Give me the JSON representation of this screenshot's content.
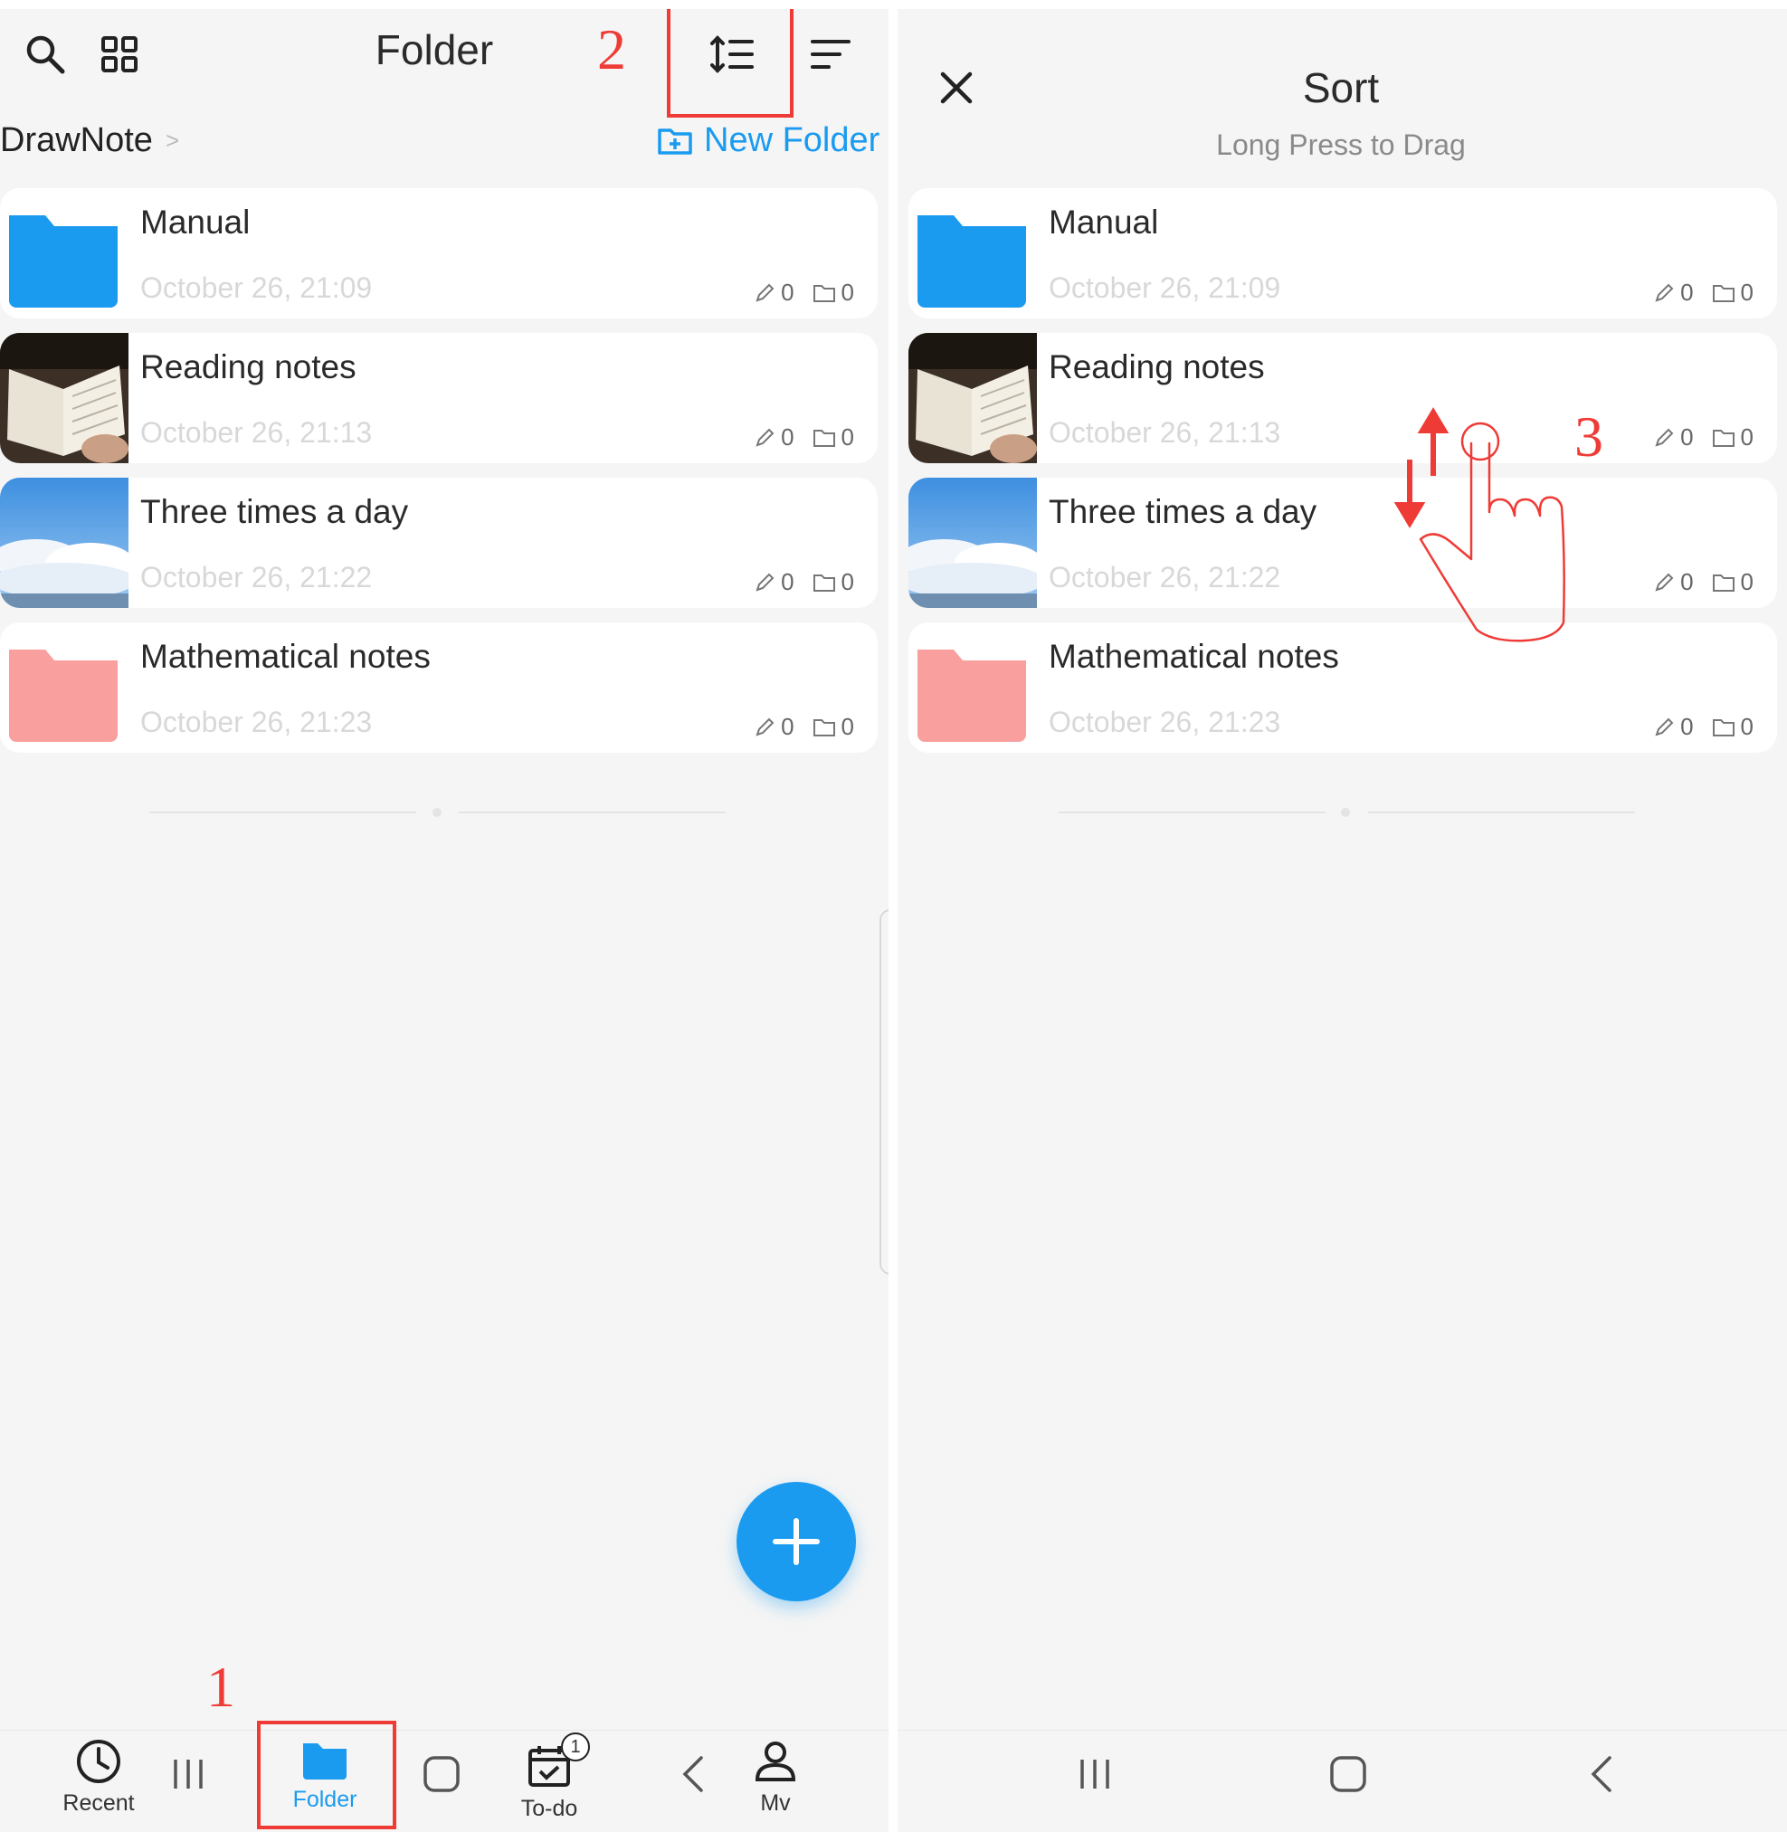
{
  "left": {
    "header": {
      "title": "Folder",
      "search_icon": "search-icon",
      "grid_icon": "grid-view-icon",
      "sort_icon": "sort-order-icon",
      "filter_icon": "filter-lines-icon"
    },
    "breadcrumb": {
      "root": "DrawNote",
      "chevron": ">"
    },
    "new_folder_label": "New Folder",
    "folders": [
      {
        "name": "Manual",
        "date": "October 26, 21:09",
        "notes": "0",
        "subfolders": "0",
        "thumb": "blue-folder"
      },
      {
        "name": "Reading notes",
        "date": "October 26, 21:13",
        "notes": "0",
        "subfolders": "0",
        "thumb": "book-photo"
      },
      {
        "name": "Three times a day",
        "date": "October 26, 21:22",
        "notes": "0",
        "subfolders": "0",
        "thumb": "sky-photo"
      },
      {
        "name": "Mathematical notes",
        "date": "October 26, 21:23",
        "notes": "0",
        "subfolders": "0",
        "thumb": "pink-folder"
      }
    ],
    "fab_icon": "plus-icon",
    "nav": [
      {
        "label": "Recent",
        "icon": "clock-icon"
      },
      {
        "label": "Folder",
        "icon": "folder-icon",
        "active": true
      },
      {
        "label": "To-do",
        "icon": "calendar-check-icon",
        "badge": "1"
      },
      {
        "label": "Mv",
        "icon": "person-icon"
      }
    ]
  },
  "right": {
    "header": {
      "title": "Sort",
      "subtitle": "Long Press to Drag",
      "close_icon": "close-icon"
    },
    "folders": [
      {
        "name": "Manual",
        "date": "October 26, 21:09",
        "notes": "0",
        "subfolders": "0"
      },
      {
        "name": "Reading notes",
        "date": "October 26, 21:13",
        "notes": "0",
        "subfolders": "0"
      },
      {
        "name": "Three times a day",
        "date": "October 26, 21:22",
        "notes": "0",
        "subfolders": "0"
      },
      {
        "name": "Mathematical notes",
        "date": "October 26, 21:23",
        "notes": "0",
        "subfolders": "0"
      }
    ]
  },
  "annotations": {
    "step1": "1",
    "step2": "2",
    "step3": "3"
  },
  "colors": {
    "accent": "#1a9bf0",
    "pink_folder": "#f9a09e",
    "annotation_red": "#ef3b36"
  }
}
